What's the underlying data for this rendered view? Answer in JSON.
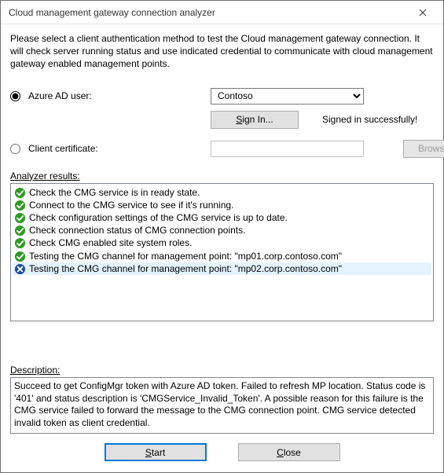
{
  "window": {
    "title": "Cloud management gateway connection analyzer"
  },
  "intro": "Please select a client authentication method to test the Cloud management gateway connection. It will check server running status and use indicated credential to communicate with cloud management gateway enabled management points.",
  "auth": {
    "azure_label": "Azure AD user:",
    "cert_label": "Client certificate:",
    "selected": "azure",
    "tenant_value": "Contoso",
    "signin_label": "Sign In...",
    "signin_status": "Signed in successfully!",
    "browse_label": "Browse...",
    "cert_value": ""
  },
  "results_label": "Analyzer results:",
  "results": [
    {
      "status": "ok",
      "text": "Check the CMG service is in ready state."
    },
    {
      "status": "ok",
      "text": "Connect to the CMG service to see if it's running."
    },
    {
      "status": "ok",
      "text": "Check configuration settings of the CMG service is up to date."
    },
    {
      "status": "ok",
      "text": "Check connection status of CMG connection points."
    },
    {
      "status": "ok",
      "text": "Check CMG enabled site system roles."
    },
    {
      "status": "ok",
      "text": "Testing the CMG channel for management point:",
      "quoted": "mp01.corp.contoso.com"
    },
    {
      "status": "fail",
      "text": "Testing the CMG channel for management point:",
      "quoted": "mp02.corp.contoso.com",
      "selected": true
    }
  ],
  "description_label": "Description:",
  "description": "Succeed to get ConfigMgr token with Azure AD token.\nFailed to refresh MP location. Status code is '401' and status description is 'CMGService_Invalid_Token'. A possible reason for this failure is the CMG service failed to forward the message to the CMG connection point. CMG service detected invalid token as client credential.",
  "footer": {
    "start_html": "<span class='mnemonic'>S</span>tart",
    "close_html": "<span class='mnemonic'>C</span>lose"
  }
}
